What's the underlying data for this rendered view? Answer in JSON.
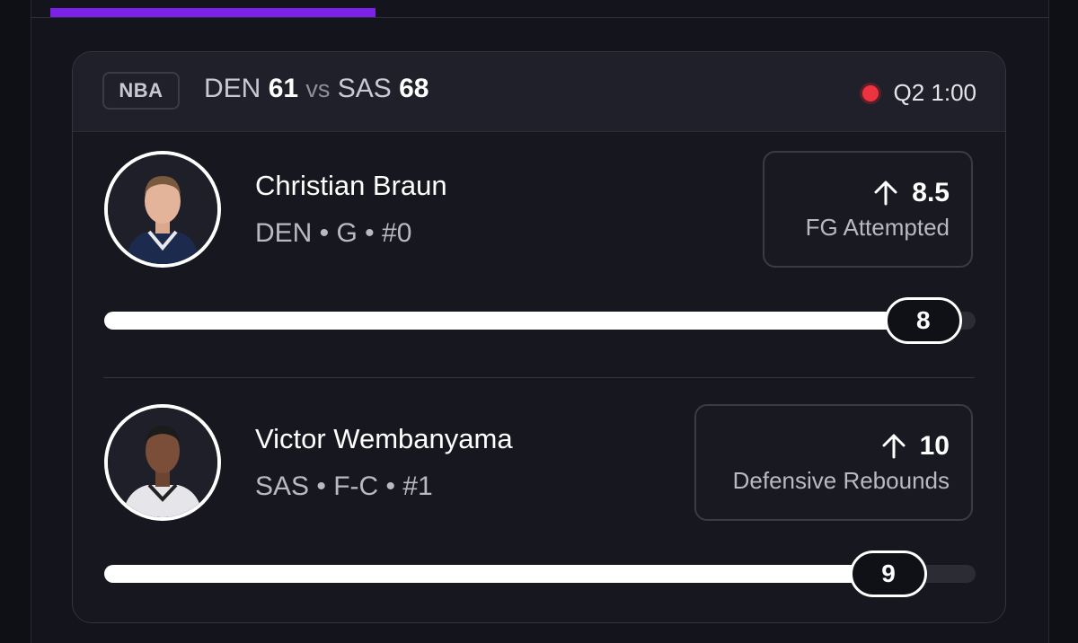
{
  "game": {
    "league": "NBA",
    "away_team": "DEN",
    "away_score": "61",
    "vs": "vs",
    "home_team": "SAS",
    "home_score": "68",
    "status": "Q2 1:00"
  },
  "colors": {
    "accent": "#7b21e9",
    "live": "#ee3340"
  },
  "players": [
    {
      "name": "Christian Braun",
      "meta": "DEN • G • #0",
      "line": "8.5",
      "stat": "FG Attempted",
      "direction_icon": "arrow-up-icon",
      "current": "8",
      "progress": 0.94
    },
    {
      "name": "Victor Wembanyama",
      "meta": "SAS • F-C • #1",
      "line": "10",
      "stat": "Defensive Rebounds",
      "direction_icon": "arrow-up-icon",
      "current": "9",
      "progress": 0.9
    }
  ]
}
